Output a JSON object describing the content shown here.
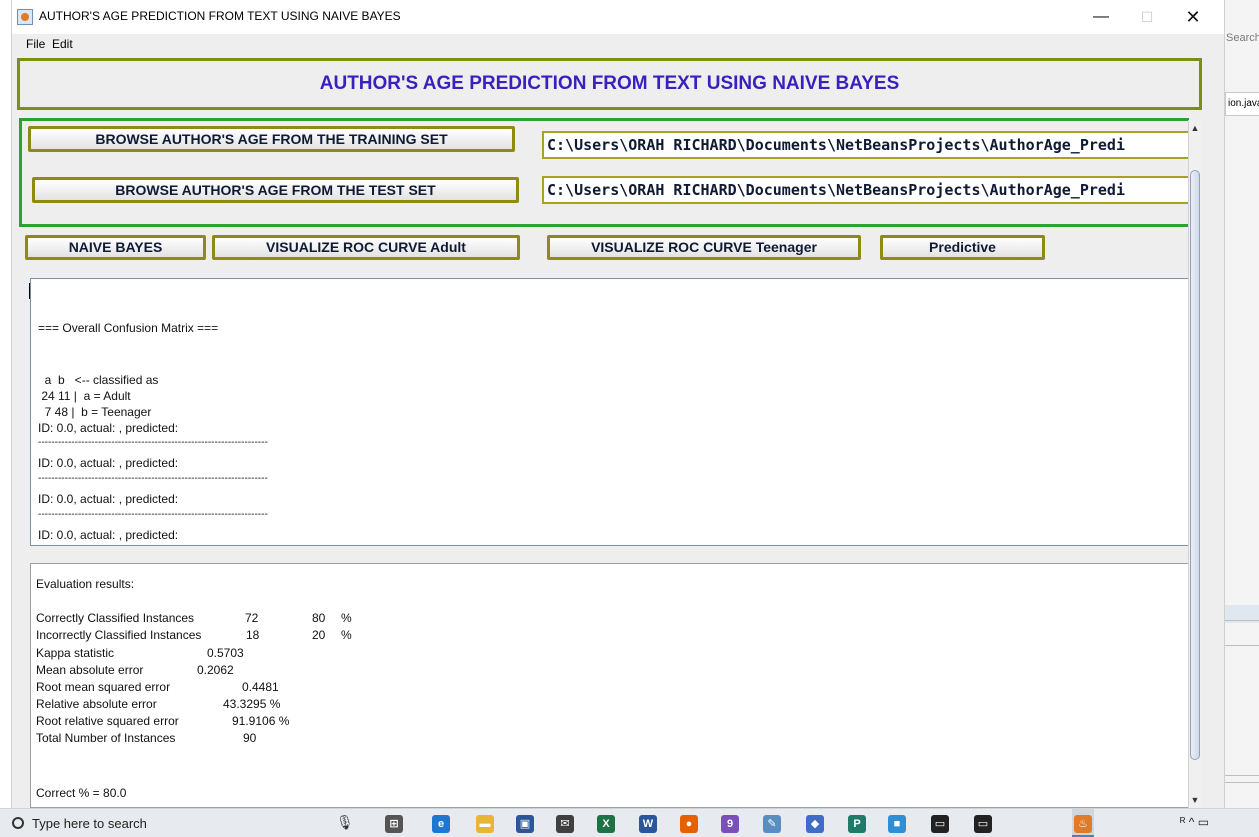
{
  "window": {
    "title": "AUTHOR'S AGE PREDICTION FROM TEXT USING NAIVE BAYES",
    "controls": {
      "minimize": "—",
      "maximize": "☐",
      "close": "✕"
    }
  },
  "menu": [
    "File",
    "Edit"
  ],
  "header": {
    "title": "AUTHOR'S AGE PREDICTION FROM TEXT USING NAIVE BAYES"
  },
  "browse": {
    "training_button": "BROWSE AUTHOR'S AGE FROM THE TRAINING SET",
    "training_path": "C:\\Users\\ORAH RICHARD\\Documents\\NetBeansProjects\\AuthorAge_Predi",
    "test_button": "BROWSE AUTHOR'S AGE FROM THE TEST SET",
    "test_path": "C:\\Users\\ORAH RICHARD\\Documents\\NetBeansProjects\\AuthorAge_Predi"
  },
  "actions": {
    "naive_bayes": "NAIVE BAYES",
    "roc_adult": "VISUALIZE ROC CURVE Adult",
    "roc_teenager": "VISUALIZE ROC CURVE Teenager",
    "predictive": "Predictive"
  },
  "output_lines": [
    "=== Overall Confusion Matrix ===",
    "  a  b   <-- classified as",
    " 24 11 |  a = Adult",
    "  7 48 |  b = Teenager",
    "ID: 0.0, actual: , predicted:",
    "---------------------------------------------------------------------",
    "ID: 0.0, actual: , predicted:",
    "---------------------------------------------------------------------",
    "ID: 0.0, actual: , predicted:",
    "---------------------------------------------------------------------",
    "ID: 0.0, actual: , predicted:"
  ],
  "results": {
    "heading": "Evaluation results:",
    "rows": [
      {
        "label": "Correctly Classified Instances",
        "value": "72",
        "pct": "80",
        "unit": "%"
      },
      {
        "label": "Incorrectly Classified Instances",
        "value": "18",
        "pct": "20",
        "unit": "%"
      },
      {
        "label": "Kappa statistic",
        "value": "0.5703"
      },
      {
        "label": "Mean absolute error",
        "value": "0.2062"
      },
      {
        "label": "Root mean squared error",
        "value": "0.4481"
      },
      {
        "label": "Relative absolute error",
        "value": "43.3295 %"
      },
      {
        "label": "Root relative squared error",
        "value": "91.9106 %"
      },
      {
        "label": "Total Number of Instances",
        "value": "90"
      }
    ],
    "correct": "Correct % = 80.0"
  },
  "background_ide": {
    "search": "Search",
    "tab": "ion.java"
  },
  "taskbar": {
    "search_placeholder": "Type here to search",
    "apps": [
      {
        "name": "task-view-icon",
        "glyph": "⊞",
        "color": "#555555"
      },
      {
        "name": "edge-icon",
        "glyph": "e",
        "color": "#1e78d2"
      },
      {
        "name": "file-explorer-icon",
        "glyph": "▬",
        "color": "#e8b534"
      },
      {
        "name": "store-icon",
        "glyph": "▣",
        "color": "#2b5797"
      },
      {
        "name": "mail-icon",
        "glyph": "✉",
        "color": "#404040"
      },
      {
        "name": "excel-icon",
        "glyph": "X",
        "color": "#1f7244"
      },
      {
        "name": "word-icon",
        "glyph": "W",
        "color": "#2b579a"
      },
      {
        "name": "firefox-icon",
        "glyph": "●",
        "color": "#e66000"
      },
      {
        "name": "visual-studio-icon",
        "glyph": "9",
        "color": "#7a4fb7"
      },
      {
        "name": "notepad-icon",
        "glyph": "✎",
        "color": "#5a8dc2"
      },
      {
        "name": "tablet-icon",
        "glyph": "◆",
        "color": "#3f6cc4"
      },
      {
        "name": "publisher-icon",
        "glyph": "P",
        "color": "#207a6a"
      },
      {
        "name": "box-icon",
        "glyph": "■",
        "color": "#2f8fd6"
      },
      {
        "name": "terminal-icon",
        "glyph": "▭",
        "color": "#222222"
      },
      {
        "name": "terminal-icon-2",
        "glyph": "▭",
        "color": "#222222"
      },
      {
        "name": "java-icon",
        "glyph": "♨",
        "color": "#e07b29"
      }
    ],
    "tray": "ᴿ ^ ▭"
  }
}
